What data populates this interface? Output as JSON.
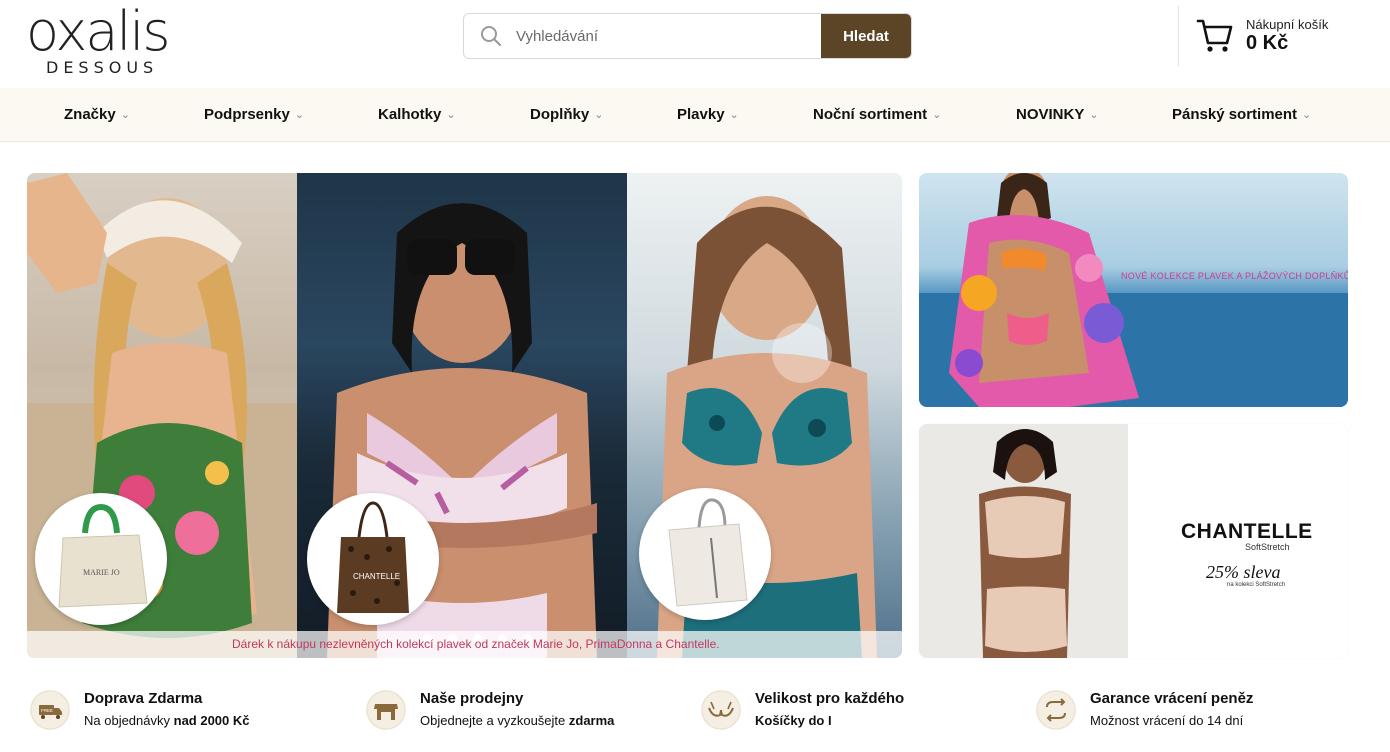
{
  "logo": {
    "word": "oxalis",
    "sub": "DESSOUS"
  },
  "search": {
    "placeholder": "Vyhledávání",
    "button": "Hledat"
  },
  "cart": {
    "label": "Nákupní košík",
    "price": "0 Kč"
  },
  "nav": [
    {
      "label": "Značky"
    },
    {
      "label": "Podprsenky"
    },
    {
      "label": "Kalhotky"
    },
    {
      "label": "Doplňky"
    },
    {
      "label": "Plavky"
    },
    {
      "label": "Noční sortiment"
    },
    {
      "label": "NOVINKY"
    },
    {
      "label": "Pánský sortiment"
    }
  ],
  "hero": {
    "caption": "Dárek k nákupu nezlevněných kolekcí plavek od značek Marie Jo, PrimaDonna a Chantelle.",
    "bags": [
      "MARIE JO",
      "CHANTELLE",
      ""
    ],
    "slides": 5
  },
  "promo1": {
    "text": "NOVÉ KOLEKCE PLAVEK A PLÁŽOVÝCH DOPLŇKŮ"
  },
  "promo2": {
    "brand": "CHANTELLE",
    "brand_sub": "SoftStretch",
    "discount": "25% sleva",
    "small": "na kolekci SoftStretch"
  },
  "benefits": [
    {
      "icon": "free-delivery-truck-icon",
      "title": "Doprava Zdarma",
      "text": "Na objednávky ",
      "bold": "nad 2000 Kč"
    },
    {
      "icon": "store-icon",
      "title": "Naše prodejny",
      "text": "Objednejte a vyzkoušejte ",
      "bold": "zdarma"
    },
    {
      "icon": "bra-icon",
      "title": "Velikost pro každého",
      "text": "",
      "bold": "Košíčky do I"
    },
    {
      "icon": "exchange-arrows-icon",
      "title": "Garance vrácení peněz",
      "text": "Možnost vrácení do 14 dní",
      "bold": ""
    }
  ],
  "colors": {
    "accent": "#5b4526",
    "nav_bg": "#fcf9f3",
    "caption": "#c0395d",
    "promo_text": "#d23c8b"
  }
}
